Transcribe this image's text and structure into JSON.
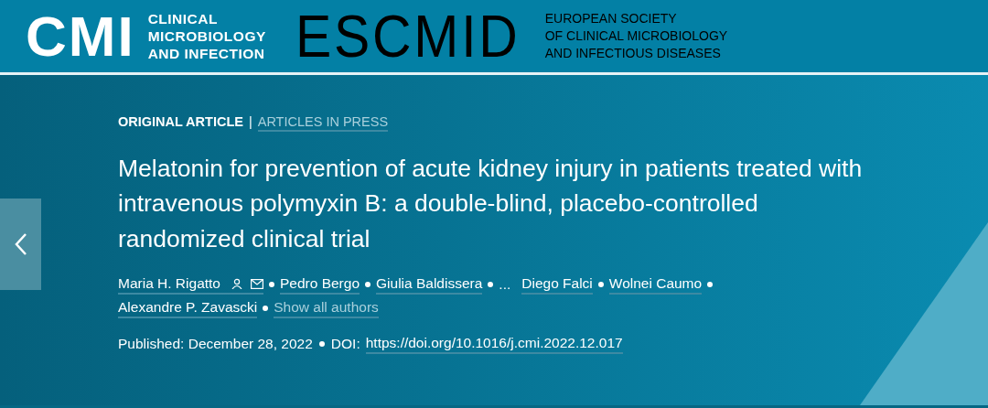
{
  "header": {
    "cmi_logo": {
      "mark": "CMI",
      "lines": [
        "CLINICAL",
        "MICROBIOLOGY",
        "AND INFECTION"
      ]
    },
    "escmid_logo": {
      "mark": "ESCMID",
      "lines": [
        "EUROPEAN SOCIETY",
        "OF CLINICAL MICROBIOLOGY",
        "AND INFECTIOUS DISEASES"
      ]
    }
  },
  "breadcrumb": {
    "type": "ORIGINAL ARTICLE",
    "separator": "|",
    "section": "ARTICLES IN PRESS"
  },
  "title": "Melatonin for prevention of acute kidney injury in patients treated with intravenous polymyxin B: a double-blind, placebo-controlled randomized clinical trial",
  "authors": [
    {
      "kind": "author",
      "text": "Maria H. Rigatto",
      "contact": true
    },
    {
      "kind": "author",
      "text": "Pedro Bergo",
      "contact": false
    },
    {
      "kind": "author",
      "text": "Giulia Baldissera",
      "contact": false
    },
    {
      "kind": "ellipsis",
      "text": "..."
    },
    {
      "kind": "author",
      "text": "Diego Falci",
      "contact": false
    },
    {
      "kind": "author",
      "text": "Wolnei Caumo",
      "contact": false
    },
    {
      "kind": "author",
      "text": "Alexandre P. Zavascki",
      "contact": false
    },
    {
      "kind": "more",
      "text": "Show all authors"
    }
  ],
  "published": "Published: December 28, 2022",
  "doi": {
    "label": "DOI:",
    "link": "https://doi.org/10.1016/j.cmi.2022.12.017"
  }
}
